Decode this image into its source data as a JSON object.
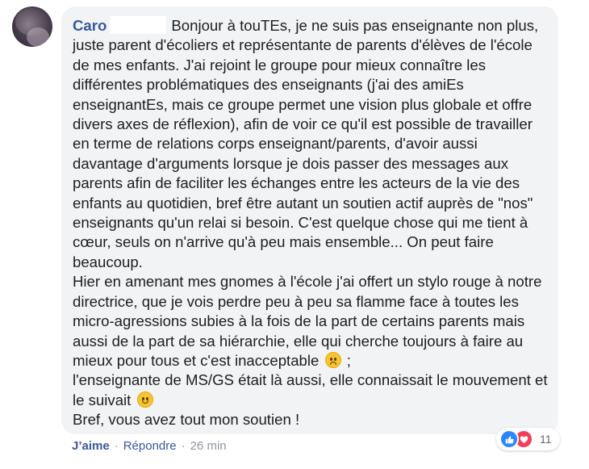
{
  "comment": {
    "author": "Caro",
    "paragraph_1": "Bonjour à touTEs, je ne suis pas enseignante non plus, juste parent d'écoliers et représentante de parents d'élèves de l'école de mes enfants. J'ai rejoint le groupe pour mieux connaître les différentes problématiques des enseignants (j'ai des amiEs enseignantEs, mais ce groupe permet une vision plus globale et offre divers axes de réflexion), afin de voir ce qu'il est possible de travailler en terme de relations corps enseignant/parents, d'avoir aussi davantage d'arguments lorsque je dois passer des messages aux parents afin de faciliter les échanges entre les acteurs de la vie des enfants au quotidien, bref être autant un soutien actif auprès de \"nos\" enseignants qu'un relai si besoin. C'est quelque chose qui me tient à cœur, seuls on n'arrive qu'à peu mais ensemble... On peut faire beaucoup.",
    "paragraph_2a": "Hier en amenant mes gnomes à l'école j'ai offert un stylo rouge à notre directrice, que je vois perdre peu à peu sa flamme face à toutes les micro-agressions subies à la fois de la part de certains parents mais aussi de la part de sa hiérarchie, elle qui cherche toujours à faire au mieux pour tous et c'est inacceptable",
    "paragraph_2b": " ;",
    "paragraph_2c": "l'enseignante de MS/GS était là aussi, elle connaissait le mouvement et le suivait",
    "paragraph_3": "Bref, vous avez tout mon soutien !"
  },
  "actions": {
    "like": "J’aime",
    "separator": "·",
    "reply": "Répondre",
    "time": "26 min"
  },
  "reactions": {
    "count": "11",
    "icons": [
      "like-icon",
      "love-icon"
    ]
  },
  "colors": {
    "author": "#385898",
    "bubble": "#f2f3f5",
    "like": "#2d88ff",
    "love": "#f33e58"
  }
}
